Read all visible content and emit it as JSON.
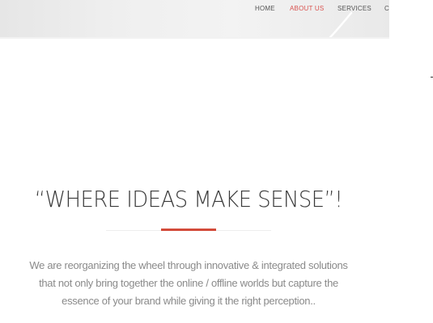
{
  "nav": {
    "items": [
      {
        "label": "HOME",
        "active": false
      },
      {
        "label": "ABOUT US",
        "active": true
      },
      {
        "label": "SERVICES",
        "active": false
      },
      {
        "label": "C",
        "active": false
      }
    ]
  },
  "hero": {
    "headline": "“WHERE IDEAS MAKE SENSE”!",
    "tagline_lines": [
      "We are reorganizing the wheel through innovative & integrated solutions",
      "that not only bring together the online / offline worlds but capture the",
      "essence of your brand while giving it the right perception.."
    ]
  },
  "colors": {
    "accent": "#d34b3a",
    "nav_active": "#d9534f",
    "text_dark": "#3a3a3a",
    "text_muted": "#8a8a8a"
  }
}
